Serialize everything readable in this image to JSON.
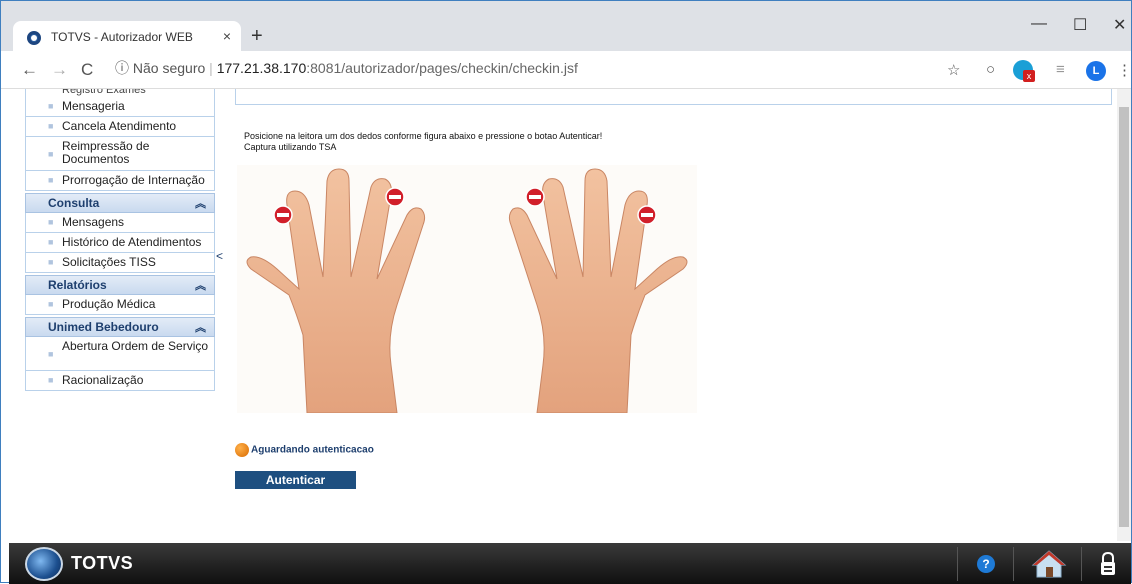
{
  "browser": {
    "tab_title": "TOTVS - Autorizador WEB",
    "tab_close": "×",
    "new_tab": "+",
    "win_minimize": "—",
    "win_maximize": "☐",
    "win_close": "✕",
    "security_label": "ⓘ Não seguro",
    "url_host": "177.21.38.170",
    "url_rest": ":8081/autorizador/pages/checkin/checkin.jsf",
    "avatar_letter": "L"
  },
  "sidebar": {
    "cut_item": "Registro Exames",
    "top_items": [
      {
        "label": "Mensageria"
      },
      {
        "label": "Cancela Atendimento"
      },
      {
        "label": "Reimpressão de Documentos"
      },
      {
        "label": "Prorrogação de Internação"
      }
    ],
    "sections": [
      {
        "title": "Consulta",
        "items": [
          {
            "label": "Mensagens"
          },
          {
            "label": "Histórico de Atendimentos"
          },
          {
            "label": "Solicitações TISS"
          }
        ]
      },
      {
        "title": "Relatórios",
        "items": [
          {
            "label": "Produção Médica"
          }
        ]
      },
      {
        "title": "Unimed Bebedouro",
        "items": [
          {
            "label": "Abertura Ordem de Serviço"
          },
          {
            "label": "Racionalização"
          }
        ]
      }
    ],
    "collapse_symbol": "<"
  },
  "main": {
    "instruction_line1": "Posicione na leitora um dos dedos conforme figura abaixo e pressione o botao Autenticar!",
    "instruction_line2": "Captura utilizando TSA",
    "status_text": "Aguardando autenticacao",
    "auth_button": "Autenticar"
  },
  "footer": {
    "brand": "TOTVS",
    "help_symbol": "?"
  },
  "colors": {
    "accent": "#1e4f80",
    "sidebar_border": "#b9d1ea",
    "footer_bg": "#1a1a1a",
    "status_dot": "#e07a10",
    "finger_marker": "#d11f2a"
  }
}
